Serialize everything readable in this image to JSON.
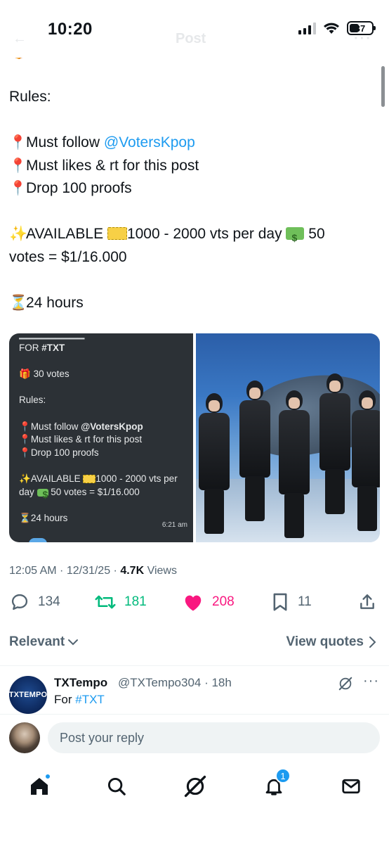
{
  "status_bar": {
    "time": "10:20",
    "battery": "37"
  },
  "header": {
    "back": "←",
    "title": "Post",
    "more": "···"
  },
  "post": {
    "lines": [
      "Rules:",
      "",
      "Must follow ",
      "Must likes & rt for this post",
      "Drop 100 proofs",
      "",
      "AVAILABLE ",
      "1000 - 2000 vts per day  ",
      " 50",
      "votes = $1/16.000",
      "",
      "24 hours"
    ],
    "mention": "@VotersKpop"
  },
  "media": {
    "left": {
      "line_for_prefix": "FOR ",
      "line_for_tag": "#TXT",
      "votes": "30 votes",
      "rules": "Rules:",
      "follow_prefix": "Must follow ",
      "follow_handle": "@VotersKpop",
      "likes": "Must likes & rt for this post",
      "drop": "Drop 100 proofs",
      "available_a": "AVAILABLE ",
      "available_b": "1000 - 2000 vts per",
      "available_c": "day ",
      "available_d": " 50 votes = $1/16.000",
      "hours": "24 hours",
      "time": "6:21 am"
    }
  },
  "meta": {
    "time": "12:05 AM · 12/31/25 · ",
    "views_count": "4.7K",
    "views_label": " Views"
  },
  "actions": {
    "replies": "134",
    "reposts": "181",
    "likes": "208",
    "bookmarks": "11"
  },
  "sort": {
    "relevant": "Relevant",
    "view_quotes": "View quotes"
  },
  "reply": {
    "avatar_text": "TXTEMPO",
    "name": "TXTempo",
    "handle": "@TXTempo304 · 18h",
    "text_prefix": "For ",
    "text_tag": "#TXT",
    "more": "···"
  },
  "composer": {
    "placeholder": "Post your reply"
  },
  "nav": {
    "notifications_badge": "1"
  },
  "colors": {
    "link": "#1d9bf0",
    "repost": "#00ba7c",
    "like": "#f91880",
    "muted": "#536471"
  },
  "icons": [
    "signal-icon",
    "wifi-icon",
    "battery-icon",
    "reply-icon",
    "repost-icon",
    "heart-icon",
    "bookmark-icon",
    "share-icon",
    "chevron-down-icon",
    "chevron-right-icon",
    "grok-icon",
    "home-icon",
    "search-icon",
    "bell-icon",
    "mail-icon"
  ]
}
